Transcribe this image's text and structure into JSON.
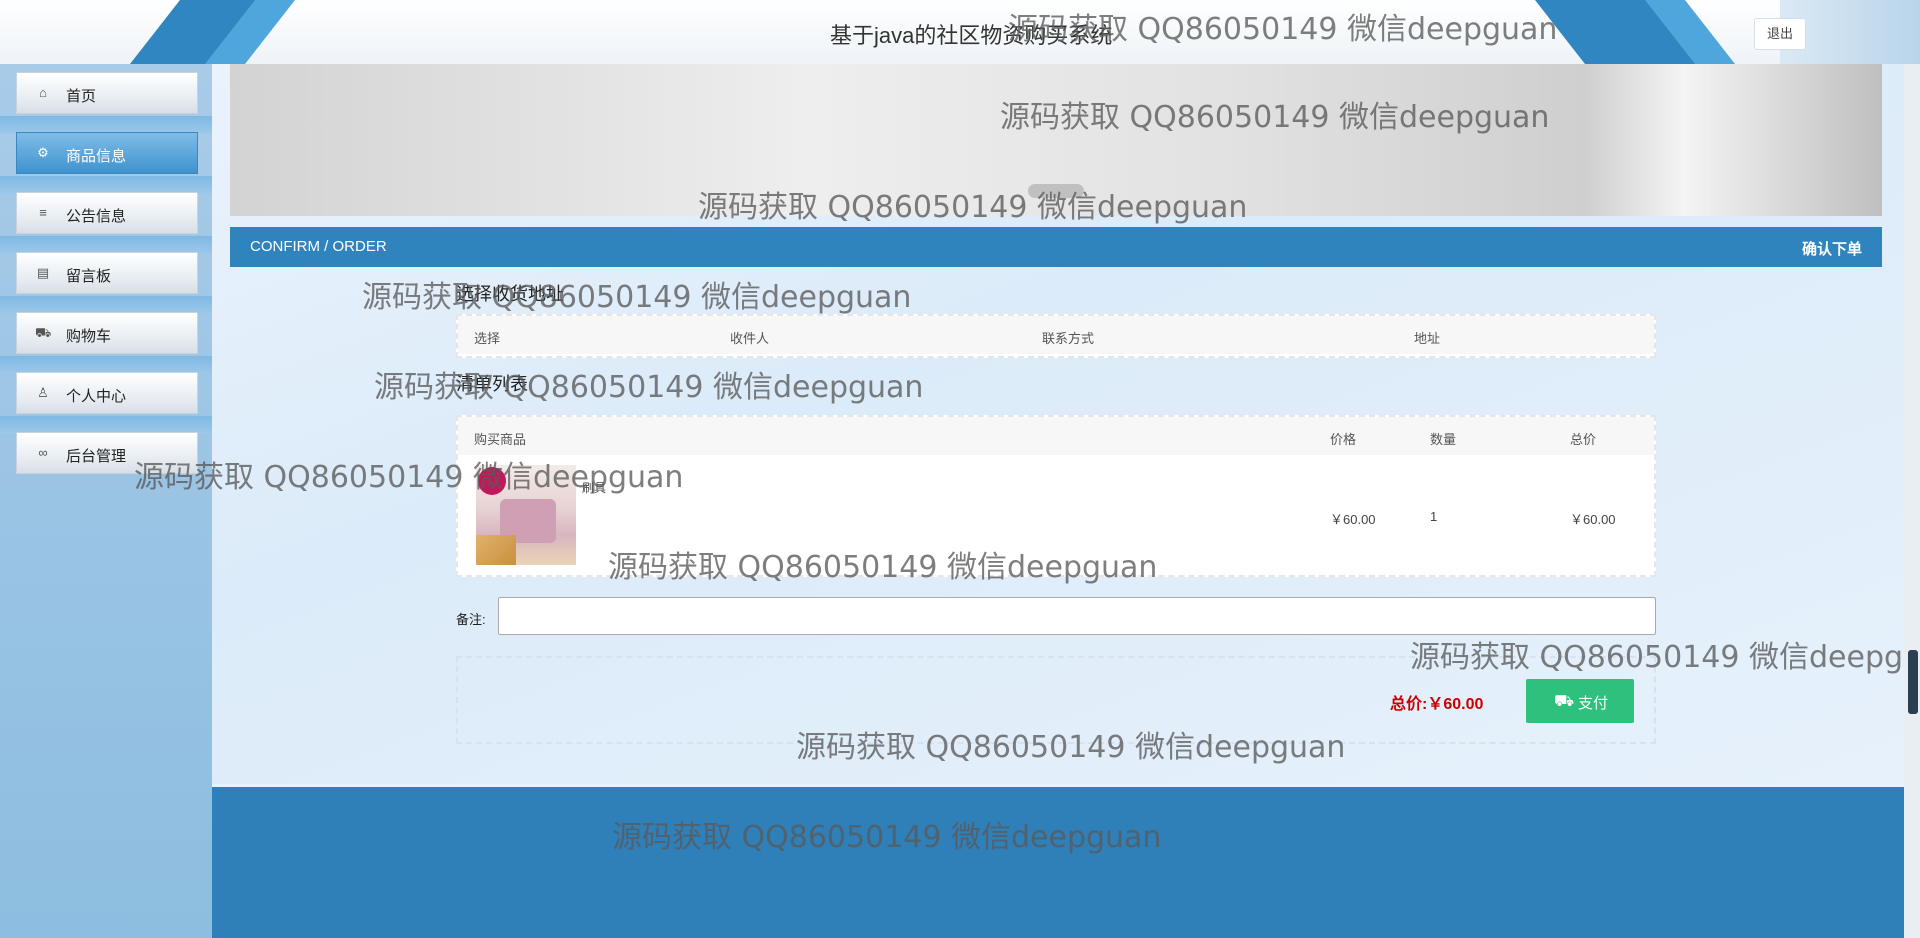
{
  "header": {
    "title": "基于java的社区物资购买系统",
    "logout_label": "退出"
  },
  "sidebar": {
    "items": [
      {
        "label": "首页",
        "icon": "home-icon"
      },
      {
        "label": "商品信息",
        "icon": "goods-icon",
        "active": true
      },
      {
        "label": "公告信息",
        "icon": "notice-icon"
      },
      {
        "label": "留言板",
        "icon": "message-board-icon"
      },
      {
        "label": "购物车",
        "icon": "cart-icon"
      },
      {
        "label": "个人中心",
        "icon": "user-icon"
      },
      {
        "label": "后台管理",
        "icon": "link-icon"
      }
    ]
  },
  "section": {
    "title_en": "CONFIRM / ORDER",
    "title_cn": "确认下单"
  },
  "address": {
    "title": "选择收货地址",
    "columns": [
      "选择",
      "收件人",
      "联系方式",
      "地址"
    ]
  },
  "order_list": {
    "title": "清单列表",
    "columns": [
      "购买商品",
      "价格",
      "数量",
      "总价"
    ],
    "items": [
      {
        "name": "刷具",
        "price": "￥60.00",
        "quantity": "1",
        "total": "￥60.00"
      }
    ]
  },
  "remark": {
    "label": "备注:",
    "value": ""
  },
  "summary": {
    "total_label": "总价:",
    "total_value": "￥60.00",
    "pay_label": "支付"
  },
  "watermark": "源码获取 QQ86050149 微信deepguan",
  "colors": {
    "primary": "#2f84bd",
    "pay_button": "#2ec07d",
    "total_text": "#cc0000",
    "sidebar_active": "#3f92cf"
  }
}
